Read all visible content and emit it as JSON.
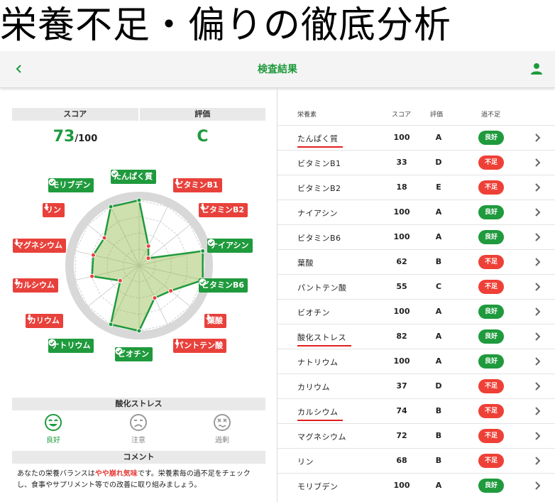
{
  "headline": "栄養不足・偏りの徹底分析",
  "appbar": {
    "title": "検査結果",
    "back_icon": "chevron-left-icon",
    "user_icon": "person-icon"
  },
  "colors": {
    "good": "#1f9a3d",
    "bad": "#e8413b",
    "accent": "#1e9a3c"
  },
  "score": {
    "header": "スコア",
    "value": "73",
    "max": "/100"
  },
  "grade": {
    "header": "評価",
    "value": "C"
  },
  "radar": {
    "scale_max": 100,
    "axes": [
      {
        "label": "たんぱく質",
        "score": 100,
        "status": "good"
      },
      {
        "label": "ビタミンB1",
        "score": 33,
        "status": "bad"
      },
      {
        "label": "ビタミンB2",
        "score": 18,
        "status": "bad"
      },
      {
        "label": "ナイアシン",
        "score": 100,
        "status": "good"
      },
      {
        "label": "ビタミンB6",
        "score": 100,
        "status": "good"
      },
      {
        "label": "葉酸",
        "score": 62,
        "status": "bad"
      },
      {
        "label": "パントテン酸",
        "score": 55,
        "status": "bad"
      },
      {
        "label": "ビオチン",
        "score": 100,
        "status": "good"
      },
      {
        "label": "ナトリウム",
        "score": 100,
        "status": "good"
      },
      {
        "label": "カリウム",
        "score": 37,
        "status": "bad"
      },
      {
        "label": "カルシウム",
        "score": 74,
        "status": "bad"
      },
      {
        "label": "マグネシウム",
        "score": 72,
        "status": "bad"
      },
      {
        "label": "リン",
        "score": 68,
        "status": "bad"
      },
      {
        "label": "モリブデン",
        "score": 100,
        "status": "good"
      }
    ]
  },
  "stress": {
    "header": "酸化ストレス",
    "faces": [
      {
        "label": "良好",
        "icon": "smile-face-icon",
        "active": true
      },
      {
        "label": "注意",
        "icon": "frown-face-icon",
        "active": false
      },
      {
        "label": "過剰",
        "icon": "dizzy-face-icon",
        "active": false
      }
    ]
  },
  "comment": {
    "header": "コメント",
    "before": "あなたの栄養バランスは",
    "highlight": "やや崩れ気味",
    "after": "です。栄養素毎の過不足をチェックし、食事やサプリメント等での改善に取り組みましょう。"
  },
  "table": {
    "headers": {
      "name": "栄養素",
      "score": "スコア",
      "grade": "評価",
      "status": "過不足"
    },
    "rows": [
      {
        "name": "たんぱく質",
        "score": "100",
        "grade": "A",
        "status": "良好",
        "kind": "good",
        "underline": true
      },
      {
        "name": "ビタミンB1",
        "score": "33",
        "grade": "D",
        "status": "不足",
        "kind": "bad",
        "underline": false
      },
      {
        "name": "ビタミンB2",
        "score": "18",
        "grade": "E",
        "status": "不足",
        "kind": "bad",
        "underline": false
      },
      {
        "name": "ナイアシン",
        "score": "100",
        "grade": "A",
        "status": "良好",
        "kind": "good",
        "underline": false
      },
      {
        "name": "ビタミンB6",
        "score": "100",
        "grade": "A",
        "status": "良好",
        "kind": "good",
        "underline": false
      },
      {
        "name": "葉酸",
        "score": "62",
        "grade": "B",
        "status": "不足",
        "kind": "bad",
        "underline": false
      },
      {
        "name": "パントテン酸",
        "score": "55",
        "grade": "C",
        "status": "不足",
        "kind": "bad",
        "underline": false
      },
      {
        "name": "ビオチン",
        "score": "100",
        "grade": "A",
        "status": "良好",
        "kind": "good",
        "underline": false
      },
      {
        "name": "酸化ストレス",
        "score": "82",
        "grade": "A",
        "status": "良好",
        "kind": "good",
        "underline": true
      },
      {
        "name": "ナトリウム",
        "score": "100",
        "grade": "A",
        "status": "良好",
        "kind": "good",
        "underline": false
      },
      {
        "name": "カリウム",
        "score": "37",
        "grade": "D",
        "status": "不足",
        "kind": "bad",
        "underline": false
      },
      {
        "name": "カルシウム",
        "score": "74",
        "grade": "B",
        "status": "不足",
        "kind": "bad",
        "underline": true
      },
      {
        "name": "マグネシウム",
        "score": "72",
        "grade": "B",
        "status": "不足",
        "kind": "bad",
        "underline": false
      },
      {
        "name": "リン",
        "score": "68",
        "grade": "B",
        "status": "不足",
        "kind": "bad",
        "underline": false
      },
      {
        "name": "モリブデン",
        "score": "100",
        "grade": "A",
        "status": "良好",
        "kind": "good",
        "underline": false
      }
    ]
  }
}
